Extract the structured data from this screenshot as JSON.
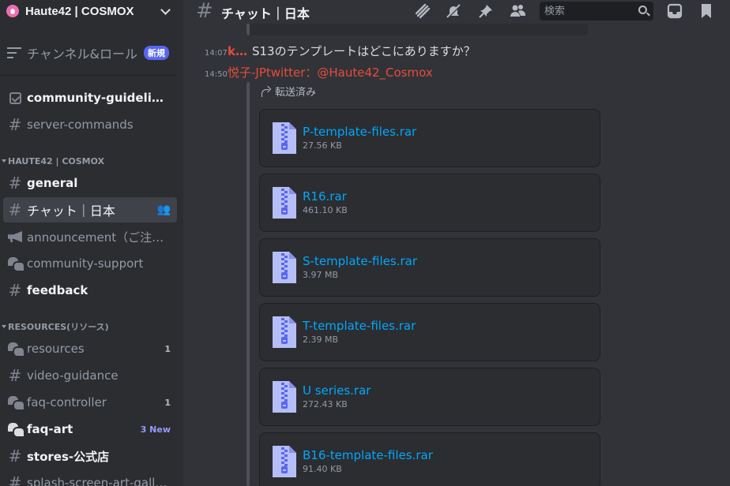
{
  "server": {
    "name": "Haute42 | COSMOX"
  },
  "browse": {
    "label": "チャンネル&ロール",
    "badge": "新規"
  },
  "sidebar": {
    "top_channels": [
      {
        "label": "community-guidelines"
      },
      {
        "label": "server-commands"
      }
    ],
    "categories": [
      {
        "label": "HAUTE42 | COSMOX"
      },
      {
        "label": "RESOURCES(リソース)"
      }
    ],
    "cat1_channels": [
      {
        "label": "general"
      },
      {
        "label": "チャット｜日本"
      },
      {
        "label": "announcement（ご注意…"
      },
      {
        "label": "community-support"
      },
      {
        "label": "feedback"
      }
    ],
    "cat2_channels": [
      {
        "label": "resources",
        "count": "1"
      },
      {
        "label": "video-guidance"
      },
      {
        "label": "faq-controller",
        "count": "1"
      },
      {
        "label": "faq-art",
        "count": "3 New"
      },
      {
        "label": "stores-公式店"
      },
      {
        "label": "splash-screen-art-gallery"
      }
    ]
  },
  "header": {
    "title": "チャット｜日本",
    "search_placeholder": "検索"
  },
  "messages": [
    {
      "time": "14:07",
      "author": "k…",
      "text": "S13のテンプレートはどこにありますか？"
    },
    {
      "time": "14:50",
      "author": "悦子-JPtwitter：@Haute42_Cosmox"
    }
  ],
  "forwarded": {
    "label": "転送済み"
  },
  "attachments": [
    {
      "name": "P-template-files.rar",
      "size": "27.56 KB"
    },
    {
      "name": "R16.rar",
      "size": "461.10 KB"
    },
    {
      "name": "S-template-files.rar",
      "size": "3.97 MB"
    },
    {
      "name": "T-template-files.rar",
      "size": "2.39 MB"
    },
    {
      "name": "U series.rar",
      "size": "272.43 KB"
    },
    {
      "name": "B16-template-files.rar",
      "size": "91.40 KB"
    }
  ]
}
